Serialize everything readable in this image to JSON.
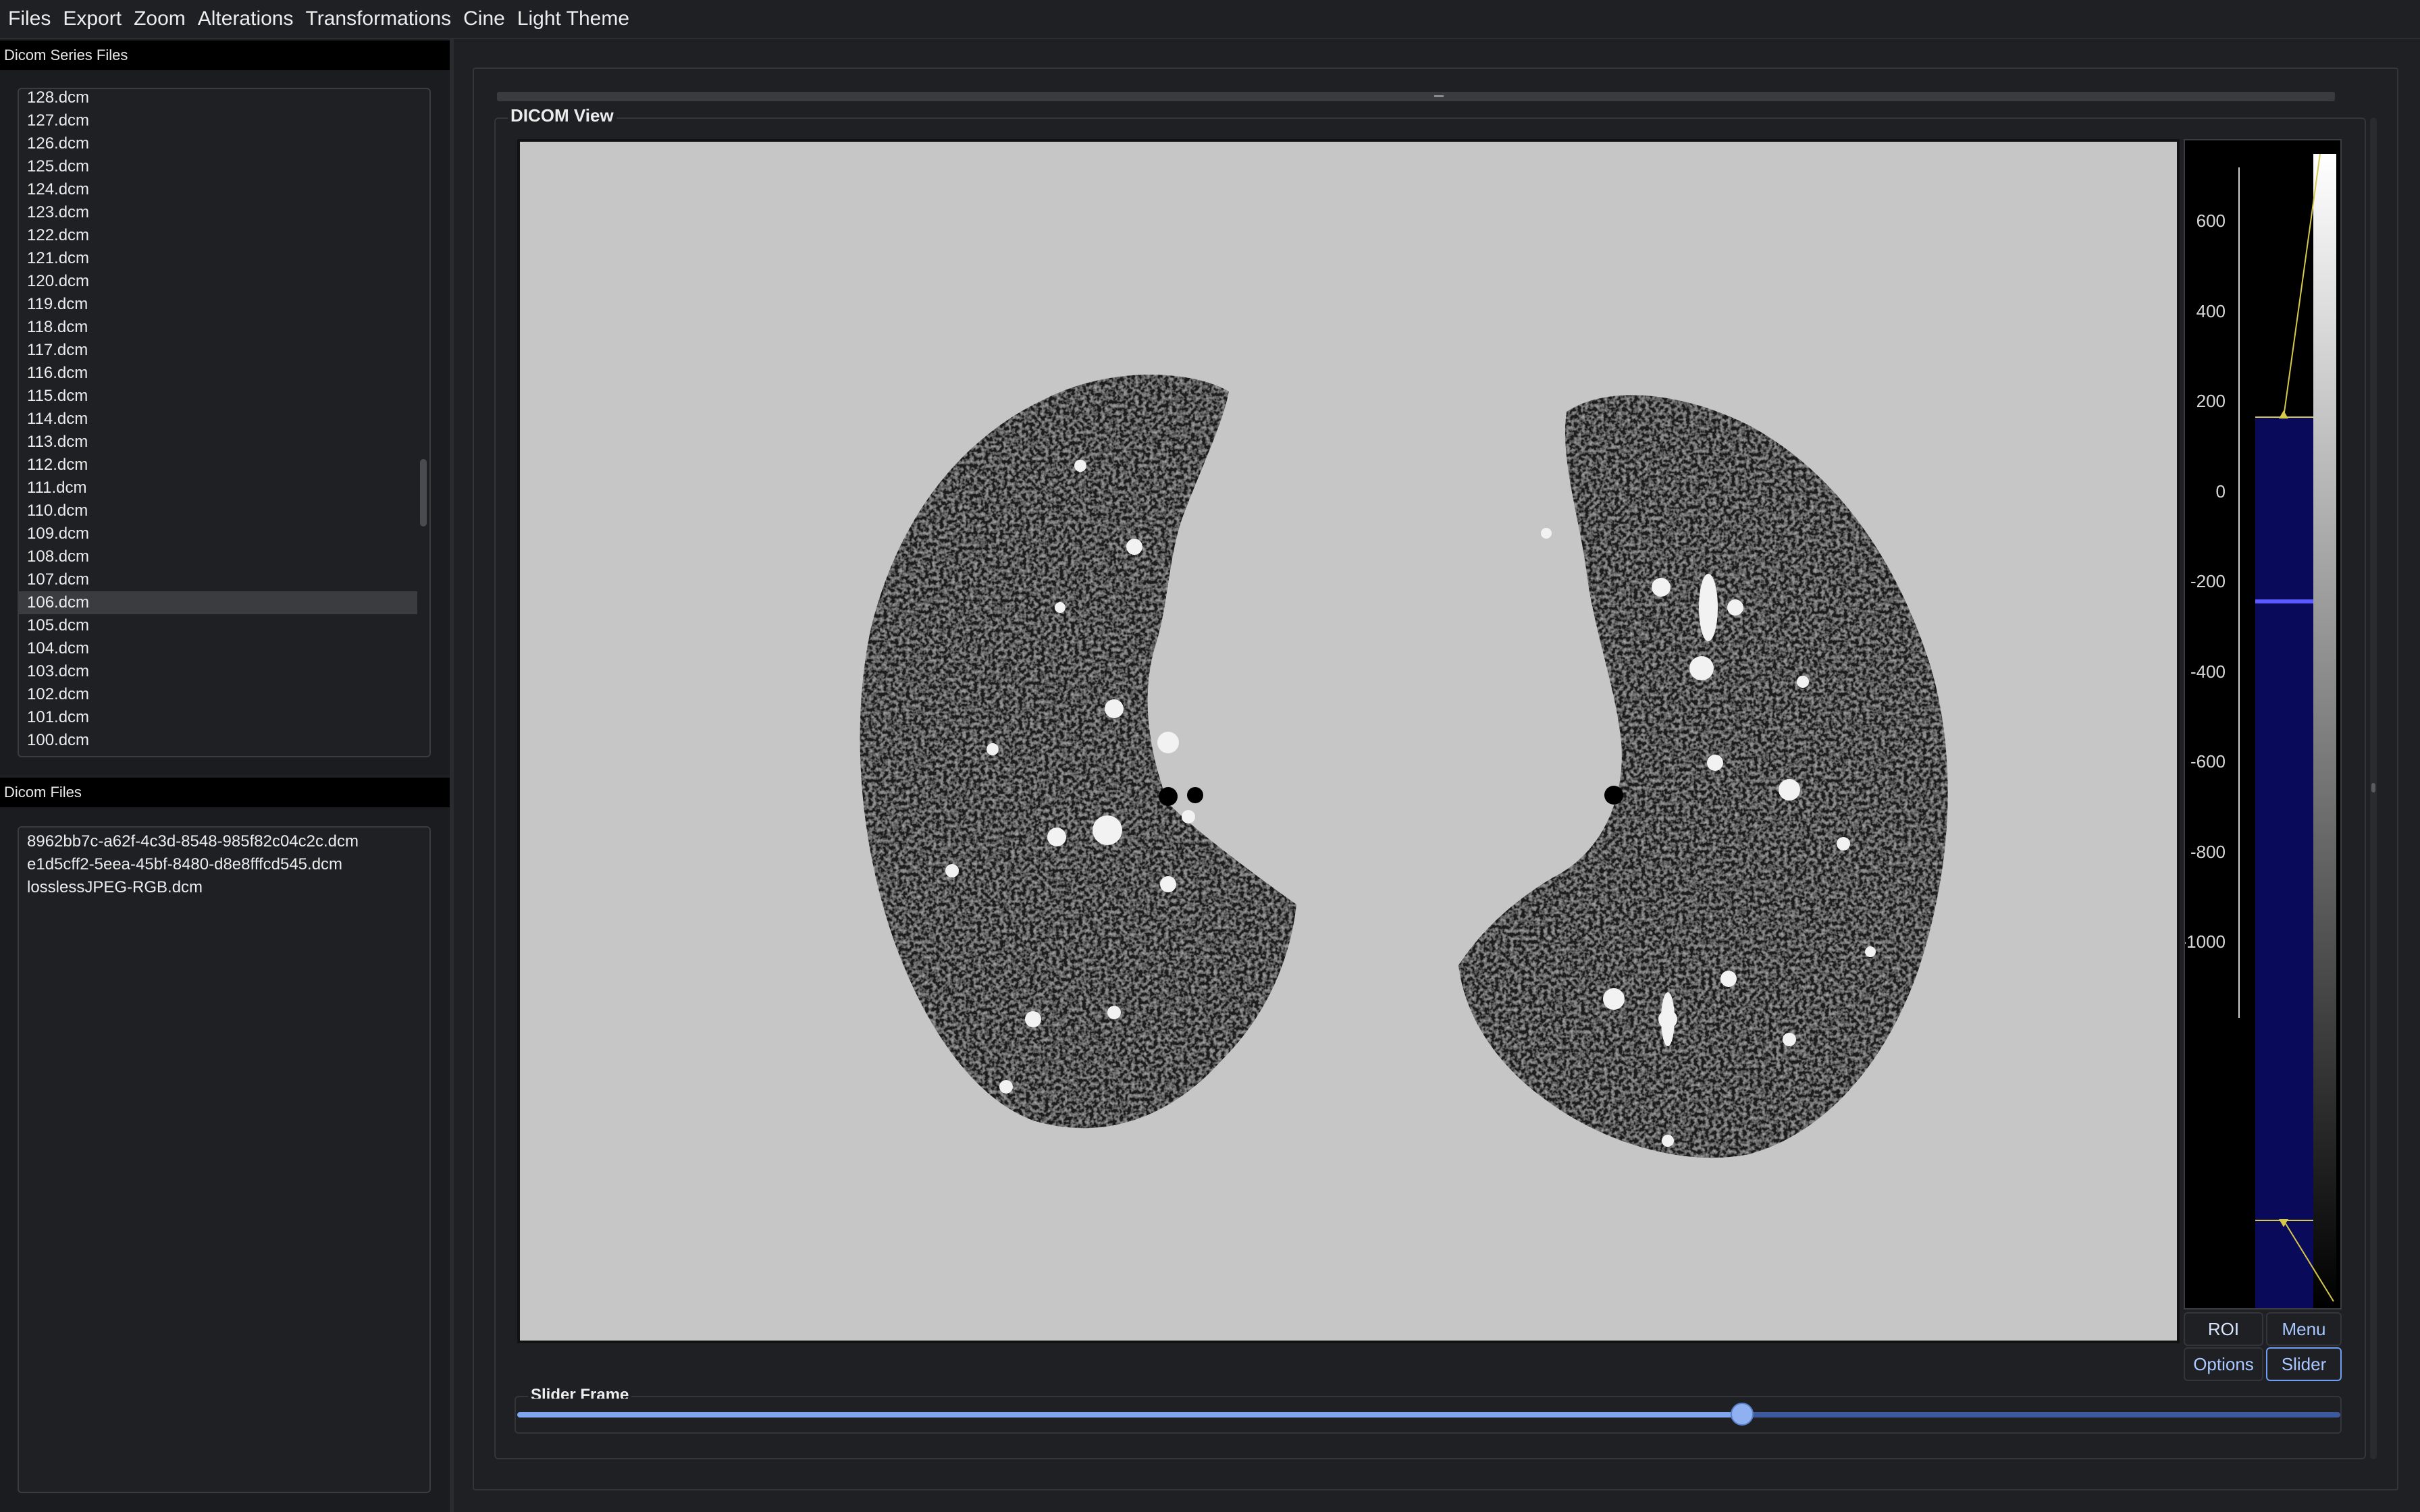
{
  "menu": [
    "Files",
    "Export",
    "Zoom",
    "Alterations",
    "Transformations",
    "Cine",
    "Light Theme"
  ],
  "series_panel": {
    "title": "Dicom Series Files",
    "items": [
      "128.dcm",
      "127.dcm",
      "126.dcm",
      "125.dcm",
      "124.dcm",
      "123.dcm",
      "122.dcm",
      "121.dcm",
      "120.dcm",
      "119.dcm",
      "118.dcm",
      "117.dcm",
      "116.dcm",
      "115.dcm",
      "114.dcm",
      "113.dcm",
      "112.dcm",
      "111.dcm",
      "110.dcm",
      "109.dcm",
      "108.dcm",
      "107.dcm",
      "106.dcm",
      "105.dcm",
      "104.dcm",
      "103.dcm",
      "102.dcm",
      "101.dcm",
      "100.dcm"
    ],
    "selected": "106.dcm"
  },
  "files_panel": {
    "title": "Dicom Files",
    "items": [
      "8962bb7c-a62f-4c3d-8548-985f82c04c2c.dcm",
      "e1d5cff2-5eea-45bf-8480-d8e8fffcd545.dcm",
      "losslessJPEG-RGB.dcm"
    ]
  },
  "view": {
    "title": "DICOM View",
    "image_alt_icon": "ct-lung-slice"
  },
  "histogram": {
    "axis_labels": [
      "600",
      "400",
      "200",
      "0",
      "-200",
      "-400",
      "-600",
      "-800",
      "-1000"
    ]
  },
  "buttons": {
    "roi": "ROI",
    "menu": "Menu",
    "options": "Options",
    "slider": "Slider"
  },
  "slider_frame": {
    "title": "Slider Frame",
    "position_fraction": 0.672
  },
  "colors": {
    "accent": "#7fa5ef",
    "background": "#1f2023",
    "histogram_fill": "#0a0a5a"
  }
}
